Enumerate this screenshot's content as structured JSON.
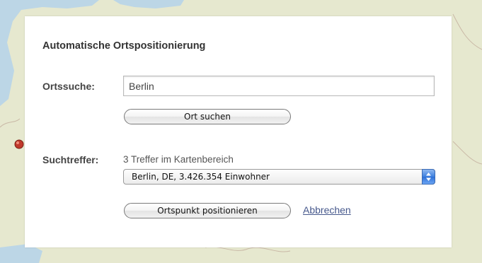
{
  "panel": {
    "title": "Automatische Ortspositionierung",
    "search_label": "Ortssuche:",
    "search_value": "Berlin",
    "search_button": "Ort suchen",
    "results_label": "Suchtreffer:",
    "results_count_text": "3 Treffer im Kartenbereich",
    "selected_result": "Berlin, DE, 3.426.354 Einwohner",
    "position_button": "Ortspunkt positionieren",
    "cancel_link": "Abbrechen"
  },
  "colors": {
    "map_land": "#e6e8cf",
    "map_water": "#bcd6e6",
    "map_border": "#c9b8a6",
    "marker": "#c0392b",
    "link": "#46588c",
    "select_arrow": "#3c7fe0"
  },
  "icons": [
    "location-marker-icon",
    "select-updown-arrows-icon"
  ]
}
